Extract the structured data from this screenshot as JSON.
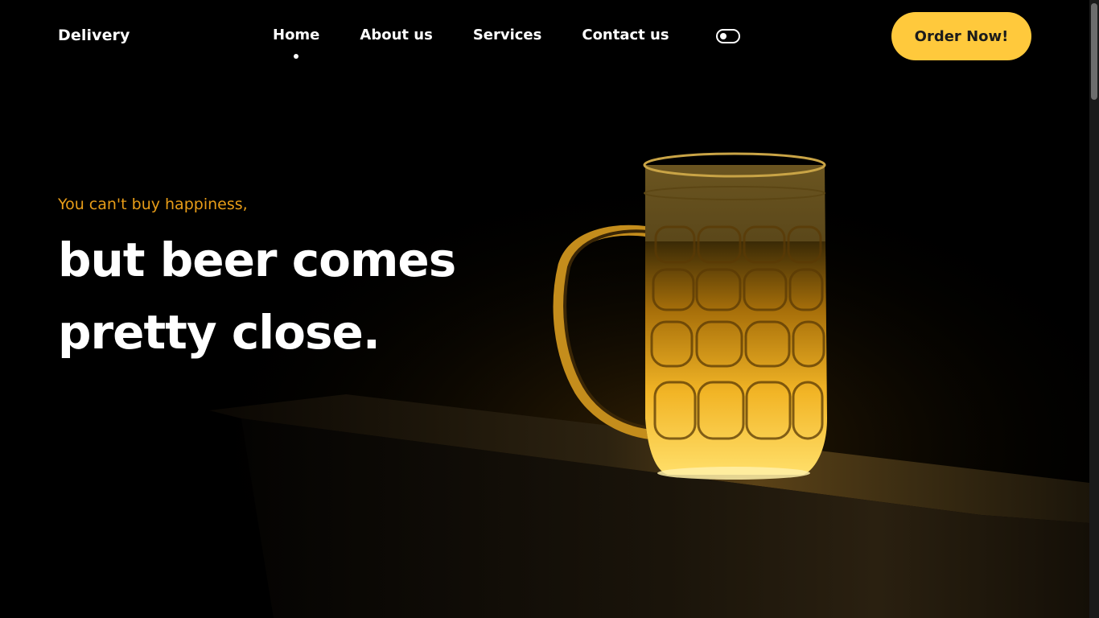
{
  "brand": {
    "logo": "Delivery"
  },
  "nav": {
    "links": [
      {
        "label": "Home",
        "active": true
      },
      {
        "label": "About us",
        "active": false
      },
      {
        "label": "Services",
        "active": false
      },
      {
        "label": "Contact us",
        "active": false
      }
    ],
    "theme_toggle_icon": "toggle-switch-icon",
    "cta_label": "Order Now!"
  },
  "hero": {
    "tagline": "You can't buy happiness,",
    "headline_line1": "but beer comes",
    "headline_line2": "pretty close.",
    "image_subject": "beer-mug-image"
  },
  "colors": {
    "background": "#000000",
    "accent": "#ffc93c",
    "tagline": "#e89d18",
    "text": "#ffffff"
  }
}
